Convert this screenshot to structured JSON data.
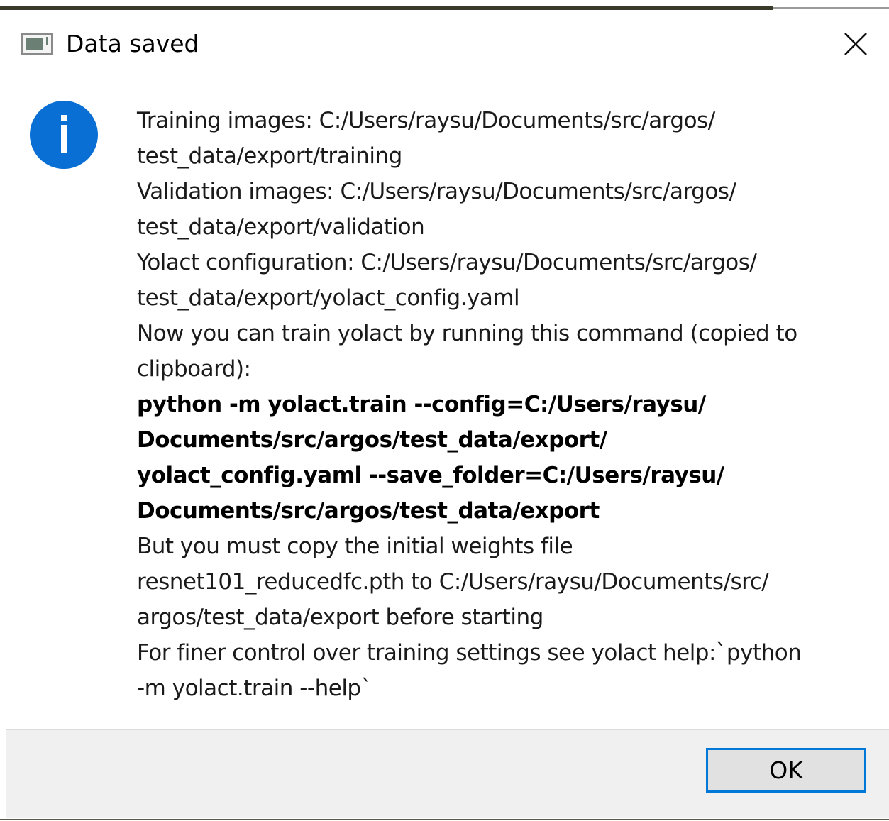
{
  "window": {
    "title": "Data saved",
    "close_symbol": "✕"
  },
  "icons": {
    "app": "app-window-icon",
    "close": "close-icon",
    "info": "information-icon",
    "info_color": "#0a6fd4"
  },
  "message": {
    "lines": [
      {
        "text": "Training images: C:/Users/raysu/Documents/src/argos/",
        "bold": false
      },
      {
        "text": "test_data/export/training",
        "bold": false
      },
      {
        "text": "Validation images: C:/Users/raysu/Documents/src/argos/",
        "bold": false
      },
      {
        "text": "test_data/export/validation",
        "bold": false
      },
      {
        "text": "Yolact configuration: C:/Users/raysu/Documents/src/argos/",
        "bold": false
      },
      {
        "text": "test_data/export/yolact_config.yaml",
        "bold": false
      },
      {
        "text": "Now you can train yolact by running this command (copied to",
        "bold": false
      },
      {
        "text": "clipboard):",
        "bold": false
      },
      {
        "text": "python -m yolact.train --config=C:/Users/raysu/",
        "bold": true
      },
      {
        "text": "Documents/src/argos/test_data/export/",
        "bold": true
      },
      {
        "text": "yolact_config.yaml --save_folder=C:/Users/raysu/",
        "bold": true
      },
      {
        "text": "Documents/src/argos/test_data/export",
        "bold": true
      },
      {
        "text": "But you must copy the initial weights file",
        "bold": false
      },
      {
        "text": "resnet101_reducedfc.pth to C:/Users/raysu/Documents/src/",
        "bold": false
      },
      {
        "text": "argos/test_data/export before starting",
        "bold": false
      },
      {
        "text": "For finer control over training settings see yolact help:`python",
        "bold": false
      },
      {
        "text": "-m yolact.train --help`",
        "bold": false
      }
    ]
  },
  "buttons": {
    "ok_label": "OK"
  },
  "colors": {
    "accent_border": "#0078d7",
    "footer_bg": "#f0f0f0",
    "button_bg": "#e1e1e1"
  }
}
